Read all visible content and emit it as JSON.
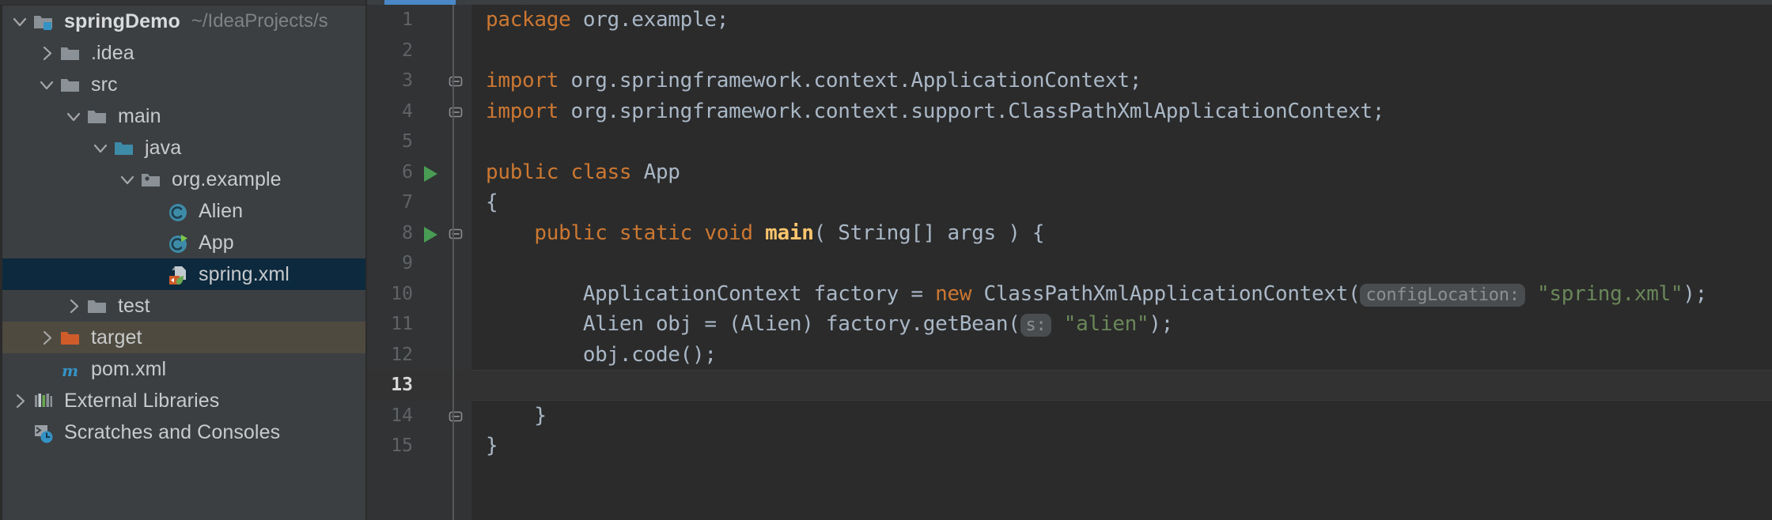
{
  "window": {
    "theme_bg": "#3c3f41",
    "editor_bg": "#2b2b2b",
    "gutter_bg": "#313335",
    "accent": "#4a88c7",
    "selection_bg": "#0d293e",
    "target_highlight_bg": "#4e4a3f"
  },
  "sidebar": {
    "items": [
      {
        "label": "springDemo",
        "sub": "~/IdeaProjects/s",
        "icon": "project-module-folder-icon",
        "twisty": "chevron-down-icon",
        "indent": 0,
        "bold": true,
        "state": "normal"
      },
      {
        "label": ".idea",
        "sub": "",
        "icon": "folder-icon",
        "twisty": "chevron-right-icon",
        "indent": 1,
        "bold": false,
        "state": "normal"
      },
      {
        "label": "src",
        "sub": "",
        "icon": "folder-icon",
        "twisty": "chevron-down-icon",
        "indent": 1,
        "bold": false,
        "state": "normal"
      },
      {
        "label": "main",
        "sub": "",
        "icon": "folder-icon",
        "twisty": "chevron-down-icon",
        "indent": 2,
        "bold": false,
        "state": "normal"
      },
      {
        "label": "java",
        "sub": "",
        "icon": "source-root-folder-icon",
        "twisty": "chevron-down-icon",
        "indent": 3,
        "bold": false,
        "state": "normal"
      },
      {
        "label": "org.example",
        "sub": "",
        "icon": "package-icon",
        "twisty": "chevron-down-icon",
        "indent": 4,
        "bold": false,
        "state": "normal"
      },
      {
        "label": "Alien",
        "sub": "",
        "icon": "java-class-icon",
        "twisty": "none",
        "indent": 5,
        "bold": false,
        "state": "normal"
      },
      {
        "label": "App",
        "sub": "",
        "icon": "java-runnable-class-icon",
        "twisty": "none",
        "indent": 5,
        "bold": false,
        "state": "normal"
      },
      {
        "label": "spring.xml",
        "sub": "",
        "icon": "spring-xml-config-icon",
        "twisty": "none",
        "indent": 5,
        "bold": false,
        "state": "selected"
      },
      {
        "label": "test",
        "sub": "",
        "icon": "folder-icon",
        "twisty": "chevron-right-icon",
        "indent": 2,
        "bold": false,
        "state": "normal"
      },
      {
        "label": "target",
        "sub": "",
        "icon": "excluded-folder-icon",
        "twisty": "chevron-right-icon",
        "indent": 1,
        "bold": false,
        "state": "highlight"
      },
      {
        "label": "pom.xml",
        "sub": "",
        "icon": "maven-pom-icon",
        "twisty": "none",
        "indent": 1,
        "bold": false,
        "state": "normal"
      },
      {
        "label": "External Libraries",
        "sub": "",
        "icon": "external-libraries-icon",
        "twisty": "chevron-right-icon",
        "indent": 0,
        "bold": false,
        "state": "normal"
      },
      {
        "label": "Scratches and Consoles",
        "sub": "",
        "icon": "scratches-consoles-icon",
        "twisty": "none",
        "indent": 0,
        "bold": false,
        "state": "normal"
      }
    ]
  },
  "editor": {
    "current_line": 13,
    "lines": [
      {
        "no": "1",
        "run": false,
        "fold": "none",
        "current": false,
        "tokens": [
          {
            "t": "package ",
            "c": "kw"
          },
          {
            "t": "org.example;",
            "c": "pln"
          }
        ]
      },
      {
        "no": "2",
        "run": false,
        "fold": "none",
        "current": false,
        "tokens": []
      },
      {
        "no": "3",
        "run": false,
        "fold": "minus-top",
        "current": false,
        "tokens": [
          {
            "t": "import ",
            "c": "kw"
          },
          {
            "t": "org.springframework.context.ApplicationContext;",
            "c": "pln"
          }
        ]
      },
      {
        "no": "4",
        "run": false,
        "fold": "minus-bottom",
        "current": false,
        "tokens": [
          {
            "t": "import ",
            "c": "kw"
          },
          {
            "t": "org.springframework.context.support.ClassPathXmlApplicationContext;",
            "c": "pln"
          }
        ]
      },
      {
        "no": "5",
        "run": false,
        "fold": "none",
        "current": false,
        "tokens": []
      },
      {
        "no": "6",
        "run": true,
        "fold": "none",
        "current": false,
        "tokens": [
          {
            "t": "public class ",
            "c": "kw"
          },
          {
            "t": "App",
            "c": "cls"
          }
        ]
      },
      {
        "no": "7",
        "run": false,
        "fold": "none",
        "current": false,
        "tokens": [
          {
            "t": "{",
            "c": "pln"
          }
        ]
      },
      {
        "no": "8",
        "run": true,
        "fold": "minus-top",
        "current": false,
        "tokens": [
          {
            "t": "    ",
            "c": "pln"
          },
          {
            "t": "public static void ",
            "c": "kw"
          },
          {
            "t": "main",
            "c": "mth"
          },
          {
            "t": "( String[] args ) {",
            "c": "pln"
          }
        ]
      },
      {
        "no": "9",
        "run": false,
        "fold": "none",
        "current": false,
        "tokens": []
      },
      {
        "no": "10",
        "run": false,
        "fold": "none",
        "current": false,
        "tokens": [
          {
            "t": "        ApplicationContext factory = ",
            "c": "pln"
          },
          {
            "t": "new ",
            "c": "kw"
          },
          {
            "t": "ClassPathXmlApplicationContext(",
            "c": "pln"
          },
          {
            "t": "configLocation:",
            "c": "hint"
          },
          {
            "t": " ",
            "c": "pln"
          },
          {
            "t": "\"spring.xml\"",
            "c": "str"
          },
          {
            "t": ");",
            "c": "pln"
          }
        ]
      },
      {
        "no": "11",
        "run": false,
        "fold": "none",
        "current": false,
        "tokens": [
          {
            "t": "        Alien obj = (Alien) factory.getBean(",
            "c": "pln"
          },
          {
            "t": "s:",
            "c": "hint"
          },
          {
            "t": " ",
            "c": "pln"
          },
          {
            "t": "\"alien\"",
            "c": "str"
          },
          {
            "t": ");",
            "c": "pln"
          }
        ]
      },
      {
        "no": "12",
        "run": false,
        "fold": "none",
        "current": false,
        "tokens": [
          {
            "t": "        obj.code();",
            "c": "pln"
          }
        ]
      },
      {
        "no": "13",
        "run": false,
        "fold": "none",
        "current": true,
        "tokens": []
      },
      {
        "no": "14",
        "run": false,
        "fold": "minus-bottom",
        "current": false,
        "tokens": [
          {
            "t": "    }",
            "c": "pln"
          }
        ]
      },
      {
        "no": "15",
        "run": false,
        "fold": "none",
        "current": false,
        "tokens": [
          {
            "t": "}",
            "c": "pln"
          }
        ]
      }
    ]
  }
}
